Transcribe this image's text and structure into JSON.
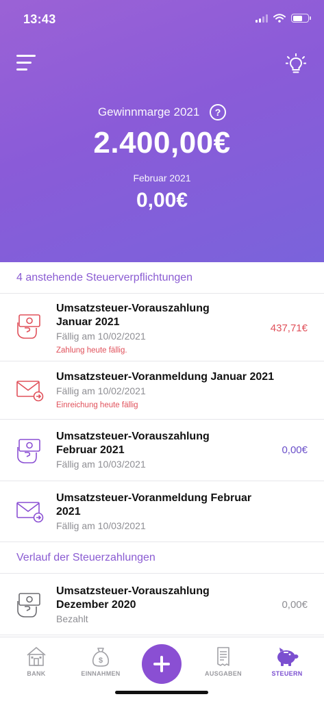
{
  "status": {
    "time": "13:43",
    "battery_level": 0.62
  },
  "header": {
    "menu_icon": "hamburger-menu-icon",
    "tip_icon": "lightbulb-icon",
    "margin_label": "Gewinnmarge 2021",
    "help_symbol": "?",
    "margin_value": "2.400,00€",
    "month_label": "Februar 2021",
    "month_value": "0,00€"
  },
  "pending": {
    "title": "4 anstehende Steuerverpflichtungen",
    "items": [
      {
        "title_line1": "Umsatzsteuer-Vorauszahlung",
        "title_line2": "Januar 2021",
        "sub": "Fällig am 10/02/2021",
        "warning": "Zahlung heute fällig.",
        "amount": "437,71€",
        "icon": "cash-payment-icon"
      },
      {
        "title_line1": "Umsatzsteuer-Voranmeldung Januar 2021",
        "sub": "Fällig am 10/02/2021",
        "warning": "Einreichung heute fällig",
        "icon": "envelope-send-icon"
      },
      {
        "title_line1": "Umsatzsteuer-Vorauszahlung",
        "title_line2": "Februar 2021",
        "sub": "Fällig am 10/03/2021",
        "amount": "0,00€",
        "icon": "cash-payment-icon"
      },
      {
        "title_line1": "Umsatzsteuer-Voranmeldung Februar",
        "title_line2": "2021",
        "sub": "Fällig am 10/03/2021",
        "icon": "envelope-send-icon"
      }
    ]
  },
  "history": {
    "title": "Verlauf der Steuerzahlungen",
    "items": [
      {
        "title_line1": "Umsatzsteuer-Vorauszahlung",
        "title_line2": "Dezember 2020",
        "sub": "Bezahlt",
        "amount": "0,00€",
        "icon": "cash-payment-icon"
      }
    ]
  },
  "tabs": [
    {
      "label": "BANK",
      "icon": "bank-icon"
    },
    {
      "label": "EINNAHMEN",
      "icon": "money-bag-icon"
    },
    {
      "label": "",
      "icon": "plus-icon"
    },
    {
      "label": "AUSGABEN",
      "icon": "receipt-icon"
    },
    {
      "label": "STEUERN",
      "icon": "piggy-bank-icon",
      "active": true
    }
  ],
  "colors": {
    "accent": "#8a4fd3",
    "hero_start": "#9b62d6",
    "hero_end": "#7a63db",
    "alert_red": "#e0505a",
    "muted_gray": "#8e8e93"
  }
}
